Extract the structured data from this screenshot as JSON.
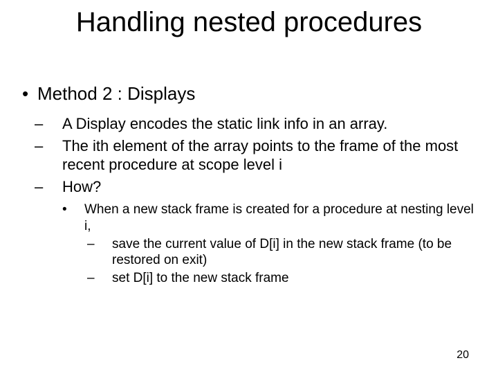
{
  "title": "Handling nested procedures",
  "method": "Method 2 : Displays",
  "sub": {
    "a": "A Display encodes the static link info in an array.",
    "b": "The ith element of the array points to the frame of the most recent procedure at scope level i",
    "c": "How?"
  },
  "how": {
    "intro": "When a new stack frame is created for a procedure at nesting level i,",
    "save": "save the current value of D[i] in the new stack frame (to be restored on exit)",
    "set": "set D[i] to the new stack frame"
  },
  "page": "20"
}
